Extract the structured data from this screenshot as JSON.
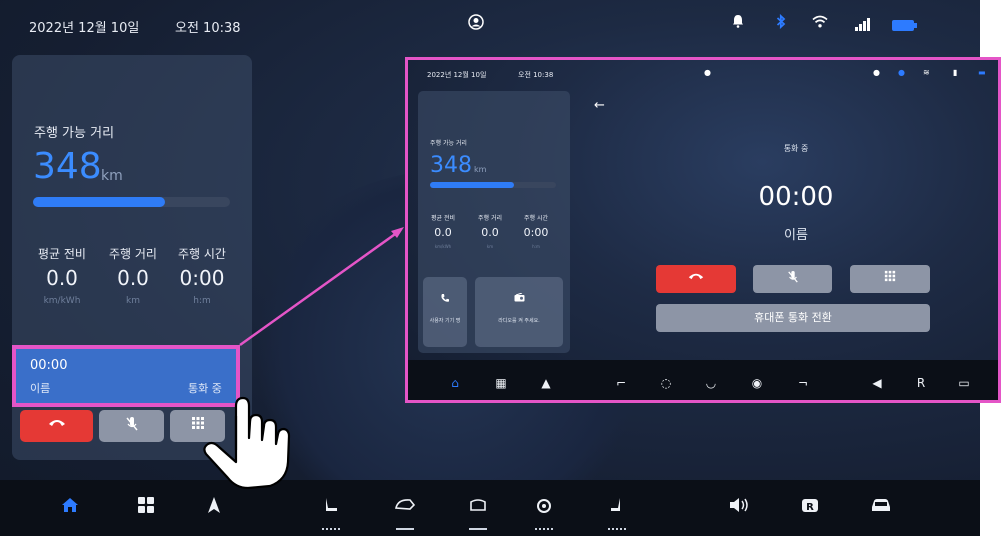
{
  "status_bar": {
    "date": "2022년 12월 10일",
    "time": "오전 10:38"
  },
  "drive_card": {
    "range_label": "주행 가능 거리",
    "range_value": "348",
    "range_unit": "km",
    "range_fill_fraction": 0.67,
    "stats": [
      {
        "label": "평균 전비",
        "value": "0.0",
        "unit": "km/kWh"
      },
      {
        "label": "주행 거리",
        "value": "0.0",
        "unit": "km"
      },
      {
        "label": "주행 시간",
        "value": "0:00",
        "unit": "h:m"
      }
    ]
  },
  "call_widget": {
    "time": "00:00",
    "name": "이름",
    "status": "통화 중"
  },
  "zoom_view": {
    "status_date": "2022년 12월 10일",
    "status_time": "오전 10:38",
    "range_label": "주행 가능 거리",
    "range_value": "348",
    "range_unit": "km",
    "stats": [
      {
        "label": "평균 전비",
        "value": "0.0",
        "unit": "km/kWh"
      },
      {
        "label": "주행 거리",
        "value": "0.0",
        "unit": "km"
      },
      {
        "label": "주행 시간",
        "value": "0:00",
        "unit": "h:m"
      }
    ],
    "tile_phone_text": "사용자 기기 명",
    "tile_radio_text": "라디오를 켜 주세요.",
    "call_status": "통화 중",
    "call_timer": "00:00",
    "call_name": "이름",
    "switch_button": "휴대폰 통화 전환"
  },
  "dock_icons": [
    "home-icon",
    "apps-icon",
    "navigation-icon",
    "seat-heat-icon",
    "ac-front-icon",
    "ac-rear-icon",
    "steering-heat-icon",
    "seat-vent-icon",
    "volume-icon",
    "camera-icon",
    "car-icon"
  ],
  "colors": {
    "accent": "#2d7bff",
    "highlight": "#e455c7",
    "end_call": "#e53935"
  }
}
